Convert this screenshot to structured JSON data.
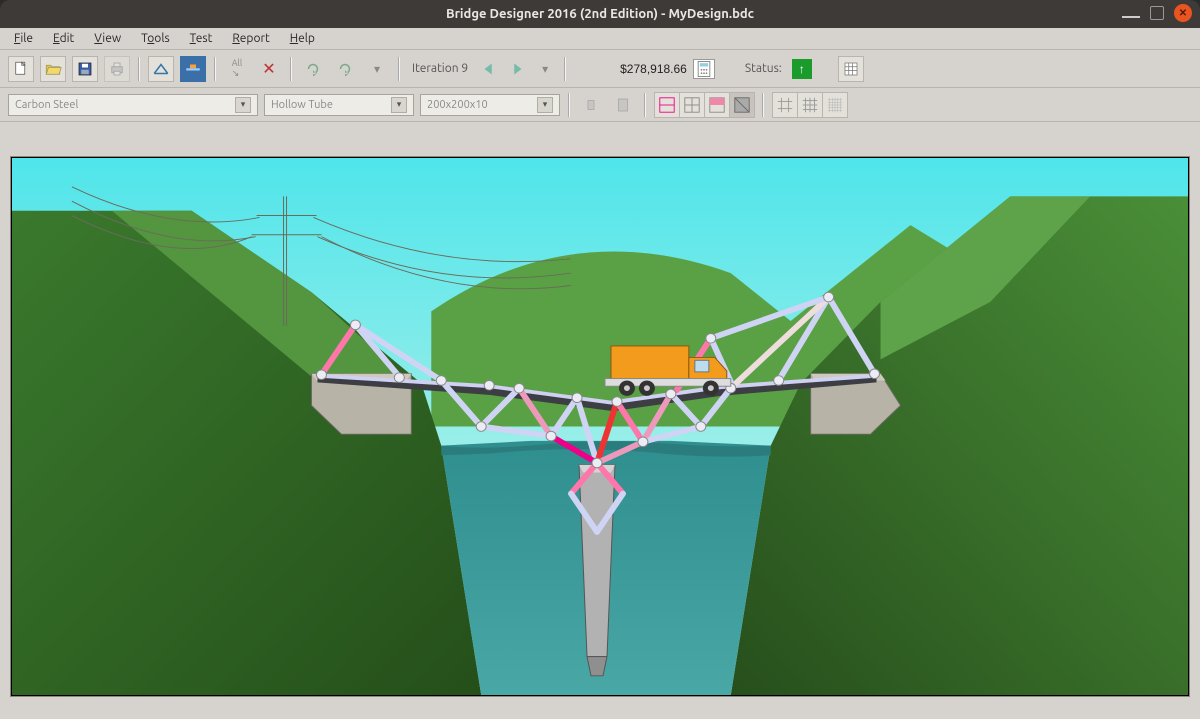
{
  "window": {
    "title": "Bridge Designer 2016 (2nd Edition) - MyDesign.bdc"
  },
  "menu": {
    "file": "File",
    "edit": "Edit",
    "view": "View",
    "tools": "Tools",
    "test": "Test",
    "report": "Report",
    "help": "Help"
  },
  "toolbar": {
    "iteration_label": "Iteration 9",
    "cost": "$278,918.66",
    "status_label": "Status:"
  },
  "dropdowns": {
    "material": "Carbon Steel",
    "section": "Hollow Tube",
    "size": "200x200x10"
  },
  "icons": {
    "new": "new",
    "open": "open",
    "save": "save",
    "print": "print",
    "tool_a": "measure",
    "tool_b": "display",
    "select": "select",
    "delete": "delete",
    "undo": "undo",
    "redo": "redo",
    "revert": "revert",
    "prev": "prev",
    "next": "next",
    "down": "down",
    "calculator": "calc",
    "status_ok": "ok",
    "spreadsheet": "grid"
  }
}
